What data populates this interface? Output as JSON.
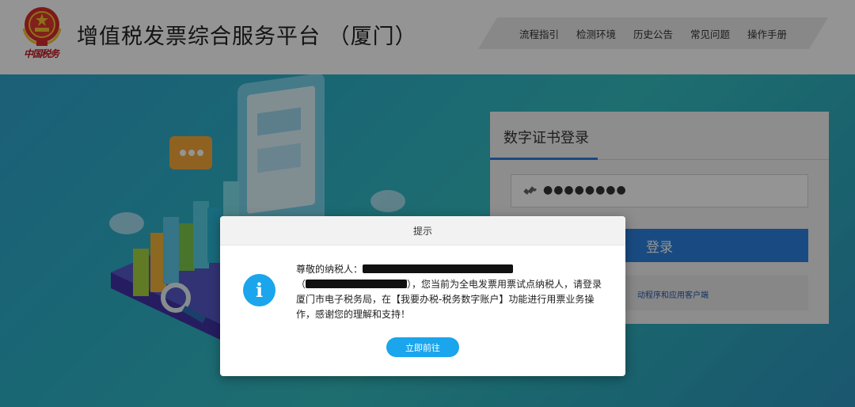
{
  "header": {
    "title": "增值税发票综合服务平台 （厦门）",
    "brand_text": "中国税务",
    "nav": [
      "流程指引",
      "检测环境",
      "历史公告",
      "常见问题",
      "操作手册"
    ]
  },
  "login": {
    "tab_label": "数字证书登录",
    "password_value": "●●●●●●●●",
    "login_button": "登录",
    "note_partial": "动程序和应用客户端"
  },
  "modal": {
    "title": "提示",
    "line1": "尊敬的纳税人：",
    "line2_open": "（",
    "line2_rest": "），您当前为全电发票用票试点纳税人，请登录",
    "line3": "厦门市电子税务局，在【我要办税-税务数字账户】功能进行用票业务操",
    "line4": "作，感谢您的理解和支持！",
    "button": "立即前往"
  },
  "colors": {
    "accent_blue": "#2c82e0",
    "info_blue": "#1aa5ec",
    "brand_red": "#c0151d"
  },
  "icons": {
    "emblem": "national-emblem-icon",
    "plug": "usb-key-icon",
    "info": "info-icon"
  }
}
